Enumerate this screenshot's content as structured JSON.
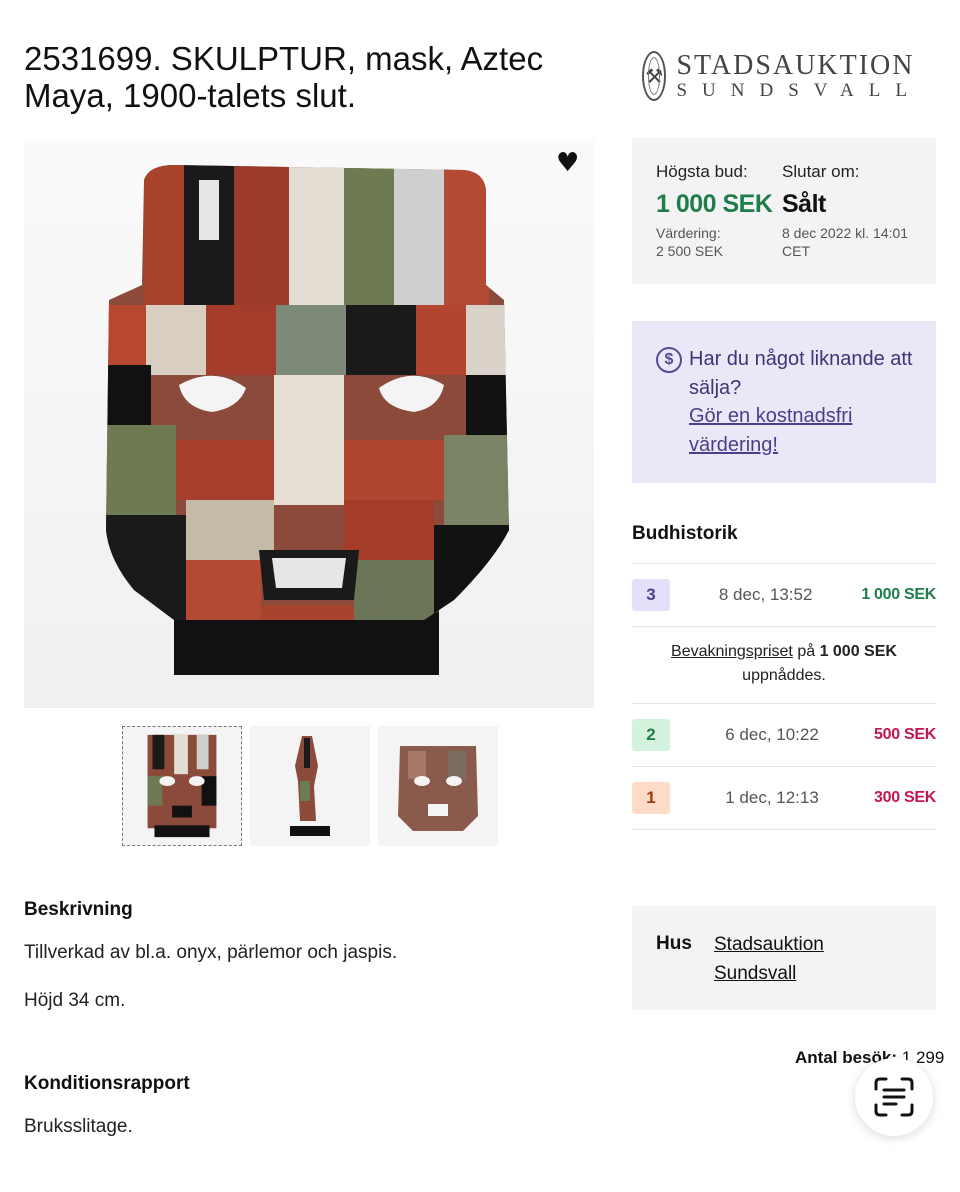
{
  "lot": {
    "title": "2531699. SKULPTUR, mask, Aztec Maya, 1900-talets slut."
  },
  "logo": {
    "line1": "STADSAUKTION",
    "line2": "SUNDSVALL"
  },
  "icons": {
    "favorite": "heart-icon",
    "money": "dollar-circle-icon",
    "scan": "text-scan-icon"
  },
  "bid_box": {
    "highest_label": "Högsta bud:",
    "highest_value": "1 000 SEK",
    "estimate_label": "Värdering:",
    "estimate_value": "2 500 SEK",
    "ends_label": "Slutar om:",
    "ends_value": "Sålt",
    "ends_date": "8 dec 2022 kl. 14:01 CET"
  },
  "sell_box": {
    "question": "Har du något liknande att sälja?",
    "link": "Gör en kostnadsfri värdering!"
  },
  "history": {
    "title": "Budhistorik",
    "rows": [
      {
        "number": "3",
        "date": "8 dec, 13:52",
        "amount": "1 000 SEK"
      },
      {
        "number": "2",
        "date": "6 dec, 10:22",
        "amount": "500 SEK"
      },
      {
        "number": "1",
        "date": "1 dec, 12:13",
        "amount": "300 SEK"
      }
    ],
    "reserve_note": {
      "link": "Bevakningspriset",
      "middle": " på ",
      "amount": "1 000 SEK",
      "end": "uppnåddes."
    }
  },
  "house": {
    "label": "Hus",
    "name": "Stadsauktion Sundsvall"
  },
  "visits": {
    "label": "Antal besök:",
    "value": "1 299"
  },
  "description": {
    "title": "Beskrivning",
    "lines": [
      "Tillverkad av bl.a. onyx, pärlemor och jaspis.",
      "Höjd 34 cm."
    ]
  },
  "condition": {
    "title": "Konditionsrapport",
    "text": "Bruksslitage."
  },
  "colors": {
    "green": "#1e7d4a",
    "red": "#c4164f",
    "purple_bg": "#e9e8f7",
    "badge3": "#e3e1fa",
    "badge2": "#d4f3dc",
    "badge1": "#fddbc7"
  }
}
